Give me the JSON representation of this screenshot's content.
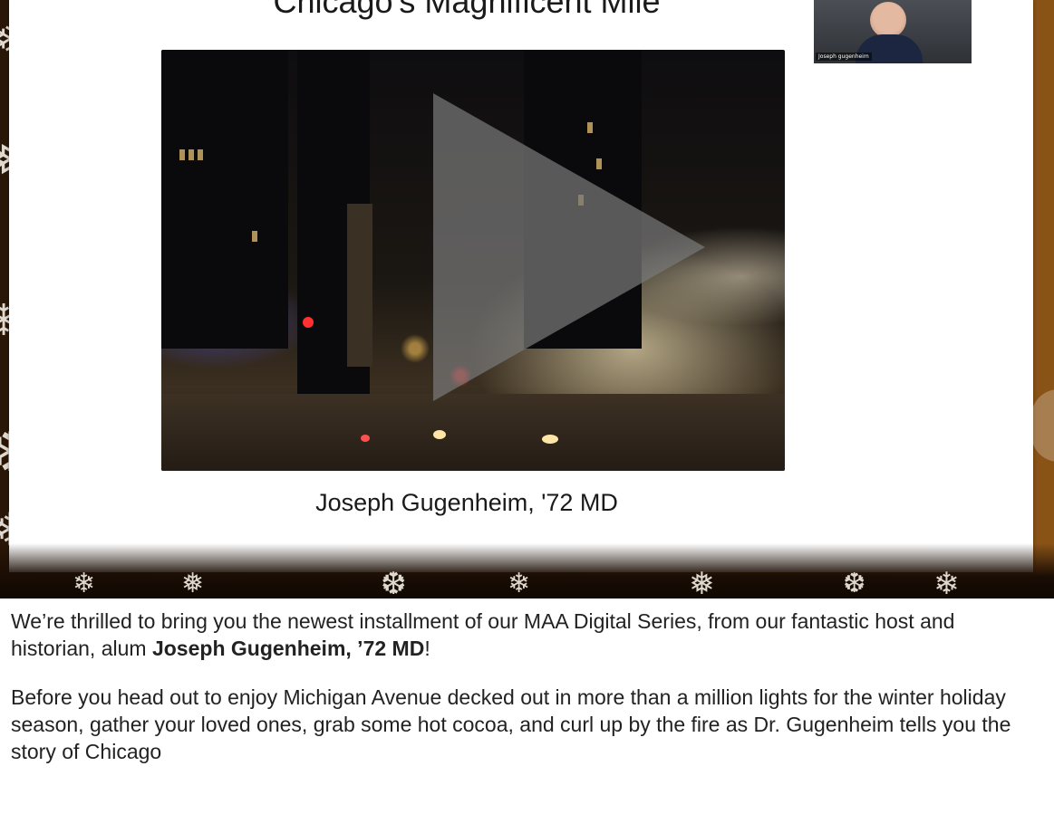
{
  "video": {
    "slide_title": "Chicago's Magnificent Mile",
    "caption": "Joseph Gugenheim, '72 MD",
    "webcam_name": "Joseph gugenheim"
  },
  "article": {
    "p1_before": "We’re thrilled to bring you the newest installment of our MAA Digital Series, from our fantastic host and historian, alum ",
    "p1_bold": "Joseph Gugenheim, ’72 MD",
    "p1_after": "!",
    "p2": "Before you head out to enjoy Michigan Avenue decked out in more than a million lights for the winter holiday season, gather your loved ones, grab some hot cocoa, and curl up by the fire as Dr. Gugenheim tells you the story of Chicago"
  },
  "colors": {
    "banner_brown": "#6a3d12",
    "play_gray": "#787878",
    "text": "#222222"
  },
  "icons": [
    "play-icon",
    "snowflake-icon"
  ]
}
